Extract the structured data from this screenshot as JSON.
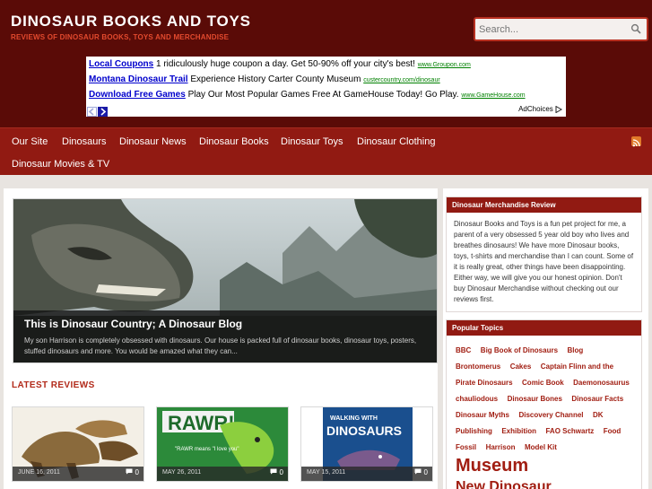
{
  "header": {
    "title": "DINOSAUR BOOKS AND TOYS",
    "tagline": "REVIEWS OF DINOSAUR BOOKS, TOYS AND MERCHANDISE",
    "search_placeholder": "Search..."
  },
  "ad": {
    "rows": [
      {
        "link": "Local Coupons",
        "text": " 1 ridiculously huge coupon a day. Get 50-90% off your city's best! ",
        "url": "www.Groupon.com"
      },
      {
        "link": "Montana Dinosaur Trail",
        "text": " Experience History Carter County Museum ",
        "url": "custercountry.com/dinosaur"
      },
      {
        "link": "Download Free Games",
        "text": " Play Our Most Popular Games Free At GameHouse Today! Go Play. ",
        "url": "www.GameHouse.com"
      }
    ],
    "adchoices": "AdChoices"
  },
  "nav": {
    "items": [
      "Our Site",
      "Dinosaurs",
      "Dinosaur News",
      "Dinosaur Books",
      "Dinosaur Toys",
      "Dinosaur Clothing",
      "Dinosaur Movies & TV"
    ]
  },
  "hero": {
    "title": "This is Dinosaur Country; A Dinosaur Blog",
    "excerpt": "My son Harrison is completely obsessed with dinosaurs.  Our house is packed full of dinosaur books, dinosaur toys, posters, stuffed dinosaurs and more.  You would be amazed what they can..."
  },
  "latest": {
    "title": "LATEST REVIEWS",
    "cards": [
      {
        "date": "JUNE 16, 2011",
        "comments": "0"
      },
      {
        "date": "MAY 26, 2011",
        "comments": "0",
        "image_text": "RAWR!",
        "bubble": "\"RAWR means \"I love you\""
      },
      {
        "date": "MAY 15, 2011",
        "comments": "0",
        "image_text_top": "WALKING WITH",
        "image_text_main": "DINOSAURS"
      }
    ]
  },
  "sidebar": {
    "about": {
      "title": "Dinosaur Merchandise Review",
      "body": "Dinosaur Books and Toys is a fun pet project for me, a parent of a very obsessed 5 year old boy who lives and breathes dinosaurs! We have more Dinosaur books, toys, t-shirts and merchandise than I can count. Some of it is really great, other things have been disappointing. Either way, we will give you our honest opinion. Don't buy Dinosaur Merchandise without checking out our reviews first."
    },
    "topics": {
      "title": "Popular Topics",
      "tags": [
        {
          "label": "BBC",
          "size": 8
        },
        {
          "label": "Big Book of Dinosaurs",
          "size": 8
        },
        {
          "label": "Blog",
          "size": 8
        },
        {
          "label": "Brontomerus",
          "size": 8
        },
        {
          "label": "Cakes",
          "size": 8
        },
        {
          "label": "Captain Flinn and the Pirate Dinosaurs",
          "size": 8
        },
        {
          "label": "Comic Book",
          "size": 8
        },
        {
          "label": "Daemonosaurus chauliodous",
          "size": 8
        },
        {
          "label": "Dinosaur Bones",
          "size": 8
        },
        {
          "label": "Dinosaur Facts",
          "size": 8
        },
        {
          "label": "Dinosaur Myths",
          "size": 8
        },
        {
          "label": "Discovery Channel",
          "size": 8
        },
        {
          "label": "DK Publishing",
          "size": 8
        },
        {
          "label": "Exhibition",
          "size": 8
        },
        {
          "label": "FAO Schwartz",
          "size": 8
        },
        {
          "label": "Food",
          "size": 8
        },
        {
          "label": "Fossil",
          "size": 8
        },
        {
          "label": "Harrison",
          "size": 8
        },
        {
          "label": "Model Kit",
          "size": 8
        },
        {
          "label": "Museum",
          "size": 20
        },
        {
          "label": "New Dinosaur",
          "size": 16
        }
      ]
    }
  },
  "colors": {
    "header_bg": "#5a0b07",
    "nav_bg": "#911a12",
    "accent": "#b22a1a"
  }
}
